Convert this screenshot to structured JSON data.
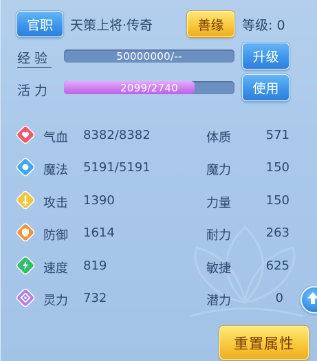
{
  "header": {
    "title_button": "官职",
    "rank_title": "天策上将·传奇",
    "karma_button": "善缘",
    "level_label": "等级: 0"
  },
  "experience": {
    "label": "经验",
    "value_text": "50000000/--",
    "fill_fraction": 0,
    "upgrade_button": "升级"
  },
  "vitality": {
    "label": "活力",
    "value_text": "2099/2740",
    "fill_fraction": 0.766,
    "use_button": "使用"
  },
  "stats": [
    {
      "icon": "heart-icon",
      "label": "气血",
      "value": "8382/8382",
      "attr_label": "体质",
      "attr_value": "571"
    },
    {
      "icon": "magic-icon",
      "label": "魔法",
      "value": "5191/5191",
      "attr_label": "魔力",
      "attr_value": "150"
    },
    {
      "icon": "sword-icon",
      "label": "攻击",
      "value": "1390",
      "attr_label": "力量",
      "attr_value": "150"
    },
    {
      "icon": "shield-icon",
      "label": "防御",
      "value": "1614",
      "attr_label": "耐力",
      "attr_value": "263"
    },
    {
      "icon": "speed-icon",
      "label": "速度",
      "value": "819",
      "attr_label": "敏捷",
      "attr_value": "625"
    },
    {
      "icon": "spirit-icon",
      "label": "灵力",
      "value": "732",
      "attr_label": "潜力",
      "attr_value": "0"
    }
  ],
  "reset_button": "重置属性",
  "colors": {
    "panel_bg": "#a9c8ea",
    "text": "#2c4a6e",
    "blue_button": "#3f95ea",
    "gold_button": "#f8c93d",
    "bar_track": "#6d90c2",
    "vitality_fill": "#d28ef0"
  }
}
